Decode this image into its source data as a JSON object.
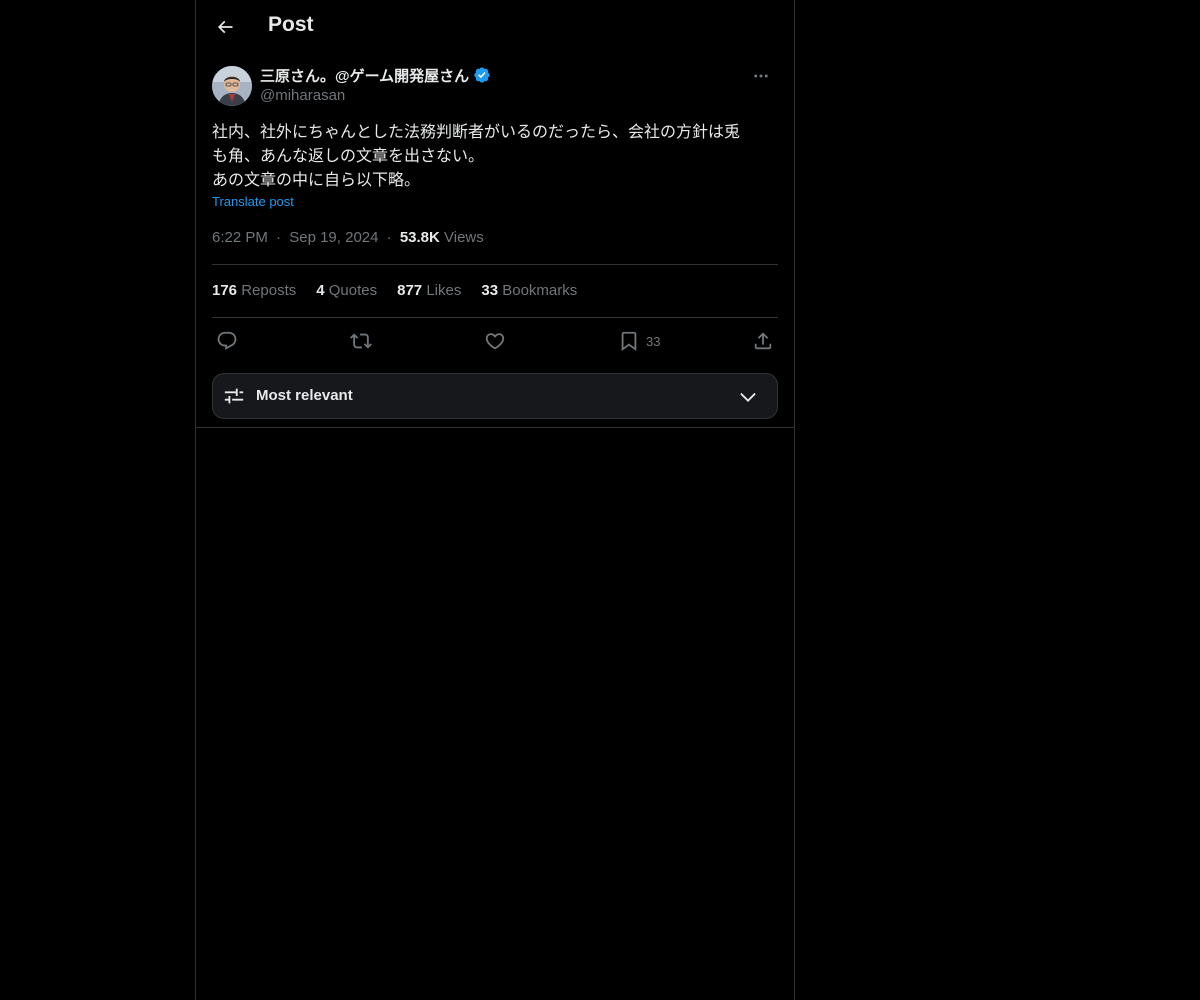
{
  "header": {
    "title": "Post"
  },
  "author": {
    "display_name": "三原さん。@ゲーム開発屋さん",
    "handle": "@miharasan",
    "verified": true
  },
  "post": {
    "text_lines": [
      "社内、社外にちゃんとした法務判断者がいるのだったら、会社の方針は兎",
      "も角、あんな返しの文章を出さない。",
      "あの文章の中に自ら以下略。"
    ],
    "translate_label": "Translate post",
    "time": "6:22 PM",
    "separator": "·",
    "date": "Sep 19, 2024",
    "views_count": "53.8K",
    "views_label": "Views"
  },
  "stats": [
    {
      "count": "176",
      "label": "Reposts"
    },
    {
      "count": "4",
      "label": "Quotes"
    },
    {
      "count": "877",
      "label": "Likes"
    },
    {
      "count": "33",
      "label": "Bookmarks"
    }
  ],
  "actions": {
    "bookmark_count": "33"
  },
  "sort": {
    "label": "Most relevant"
  },
  "colors": {
    "background": "#000000",
    "text": "#e7e9ea",
    "muted": "#71767b",
    "accent": "#1d9bf0",
    "border": "#2f3336"
  }
}
